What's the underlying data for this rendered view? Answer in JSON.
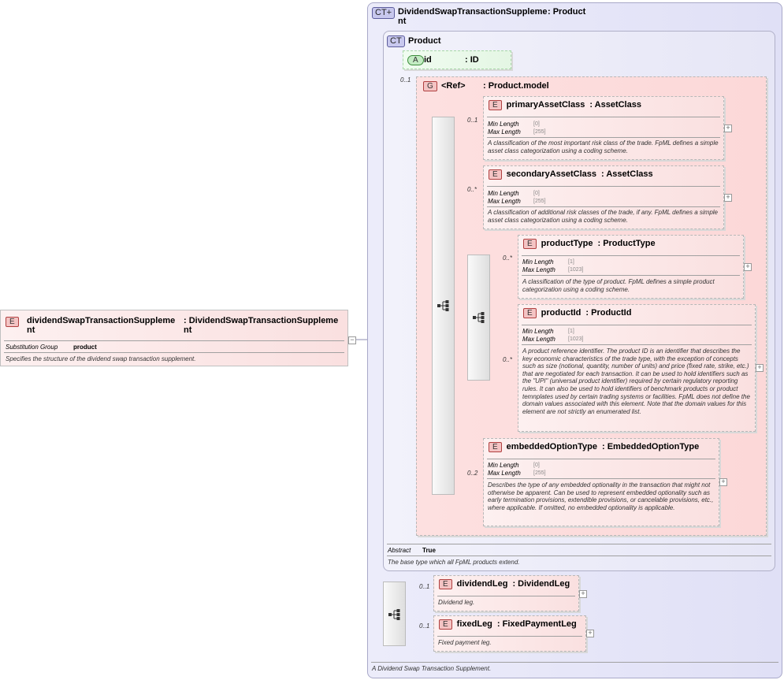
{
  "root_element": {
    "badge": "E",
    "name": "dividendSwapTransactionSuppleme\nnt",
    "type": ": DividendSwapTransactionSuppleme\nnt",
    "substitution_label": "Substitution Group",
    "substitution_value": "product",
    "doc": "Specifies the structure of the dividend swap transaction supplement."
  },
  "complex_type": {
    "badge": "CT+",
    "name": "DividendSwapTransactionSuppleme\nnt",
    "type": ": Product",
    "doc": "A Dividend Swap Transaction Supplement."
  },
  "product_type": {
    "badge": "CT",
    "name": "Product",
    "abstract_label": "Abstract",
    "abstract_value": "True",
    "doc": "The base type which all FpML products extend."
  },
  "attribute_id": {
    "badge": "A",
    "name": "id",
    "type": ": ID"
  },
  "group": {
    "badge": "G",
    "name": "<Ref>",
    "type": ": Product.model",
    "card": "0..1"
  },
  "facet_labels": {
    "min": "Min Length",
    "max": "Max Length"
  },
  "elements": {
    "primaryAssetClass": {
      "name": "primaryAssetClass",
      "type": ": AssetClass",
      "card": "0..1",
      "min": "[0]",
      "max": "[255]",
      "doc": "A classification of the most important risk class of the trade. FpML defines a simple asset class categorization using a coding scheme."
    },
    "secondaryAssetClass": {
      "name": "secondaryAssetClass",
      "type": ": AssetClass",
      "card": "0..*",
      "min": "[0]",
      "max": "[255]",
      "doc": "A classification of additional risk classes of the trade, if any. FpML defines a simple asset class categorization using a coding scheme."
    },
    "productType": {
      "name": "productType",
      "type": ": ProductType",
      "card": "0..*",
      "min": "[1]",
      "max": "[1023]",
      "doc": "A classification of the type of product. FpML defines a simple product categorization using a coding scheme."
    },
    "productId": {
      "name": "productId",
      "type": ": ProductId",
      "card": "0..*",
      "min": "[1]",
      "max": "[1023]",
      "doc": "A product reference identifier. The product ID is an identifier that describes the key economic characteristics of the trade type, with the exception of concepts such as size (notional, quantity, number of units) and price (fixed rate, strike, etc.) that are negotiated for each transaction. It can be used to hold identifiers such as the \"UPI\" (universal product identifier) required by certain regulatory reporting rules. It can also be used to hold identifiers of benchmark products or product temnplates used by certain trading systems or facilities. FpML does not define the domain values associated with this element. Note that the domain values for this element are not strictly an enumerated list."
    },
    "embeddedOptionType": {
      "name": "embeddedOptionType",
      "type": ": EmbeddedOptionType",
      "card": "0..2",
      "min": "[0]",
      "max": "[255]",
      "doc": "Describes the type of any embedded optionality in the transaction that might not otherwise be apparent. Can be used to represent embedded optionality such as early termination provisions, extendible provisions, or cancelable provisions, etc., where applicable. If omitted, no embedded optionality is applicable."
    },
    "dividendLeg": {
      "name": "dividendLeg",
      "type": ": DividendLeg",
      "card": "0..1",
      "doc": "Dividend leg."
    },
    "fixedLeg": {
      "name": "fixedLeg",
      "type": ": FixedPaymentLeg",
      "card": "0..1",
      "doc": "Fixed payment leg."
    }
  },
  "icons": {
    "element_badge": "E",
    "expand": "+",
    "collapse": "−",
    "sequence": "sequence-icon"
  },
  "colors": {
    "element_fill": "#fae0e0",
    "complex_type_fill": "#e4e4f8",
    "attribute_fill": "#e4f6e4",
    "connector": "#9090b0"
  }
}
